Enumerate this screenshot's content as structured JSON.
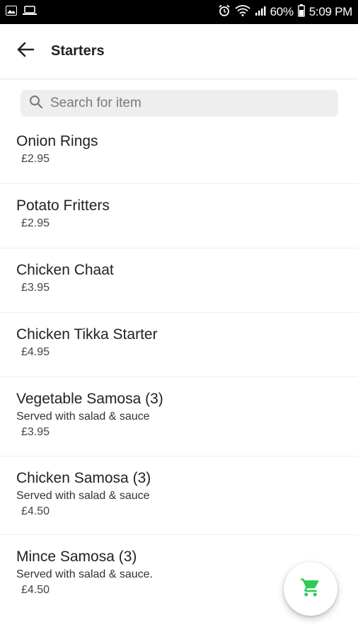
{
  "status_bar": {
    "battery_percent": "60%",
    "time": "5:09 PM",
    "icons": [
      "image-icon",
      "laptop-icon",
      "alarm-icon",
      "wifi-icon",
      "signal-icon",
      "battery-icon"
    ]
  },
  "app_bar": {
    "title": "Starters",
    "back_icon": "arrow-left-icon"
  },
  "search": {
    "placeholder": "Search for item",
    "value": "",
    "icon": "search-icon"
  },
  "items": [
    {
      "name": "Onion Rings",
      "description": "",
      "price": "£2.95"
    },
    {
      "name": "Potato Fritters",
      "description": "",
      "price": "£2.95"
    },
    {
      "name": "Chicken Chaat",
      "description": "",
      "price": "£3.95"
    },
    {
      "name": "Chicken Tikka Starter",
      "description": "",
      "price": "£4.95"
    },
    {
      "name": "Vegetable Samosa (3)",
      "description": "Served with salad & sauce",
      "price": "£3.95"
    },
    {
      "name": "Chicken Samosa (3)",
      "description": "Served with salad & sauce",
      "price": "£4.50"
    },
    {
      "name": "Mince Samosa (3)",
      "description": "Served with salad & sauce.",
      "price": "£4.50"
    }
  ],
  "cart_button": {
    "icon": "cart-icon",
    "color": "#2ecc55"
  },
  "colors": {
    "status_bar_bg": "#000000",
    "accent_green": "#2ecc55",
    "search_bg": "#eeeeee"
  }
}
